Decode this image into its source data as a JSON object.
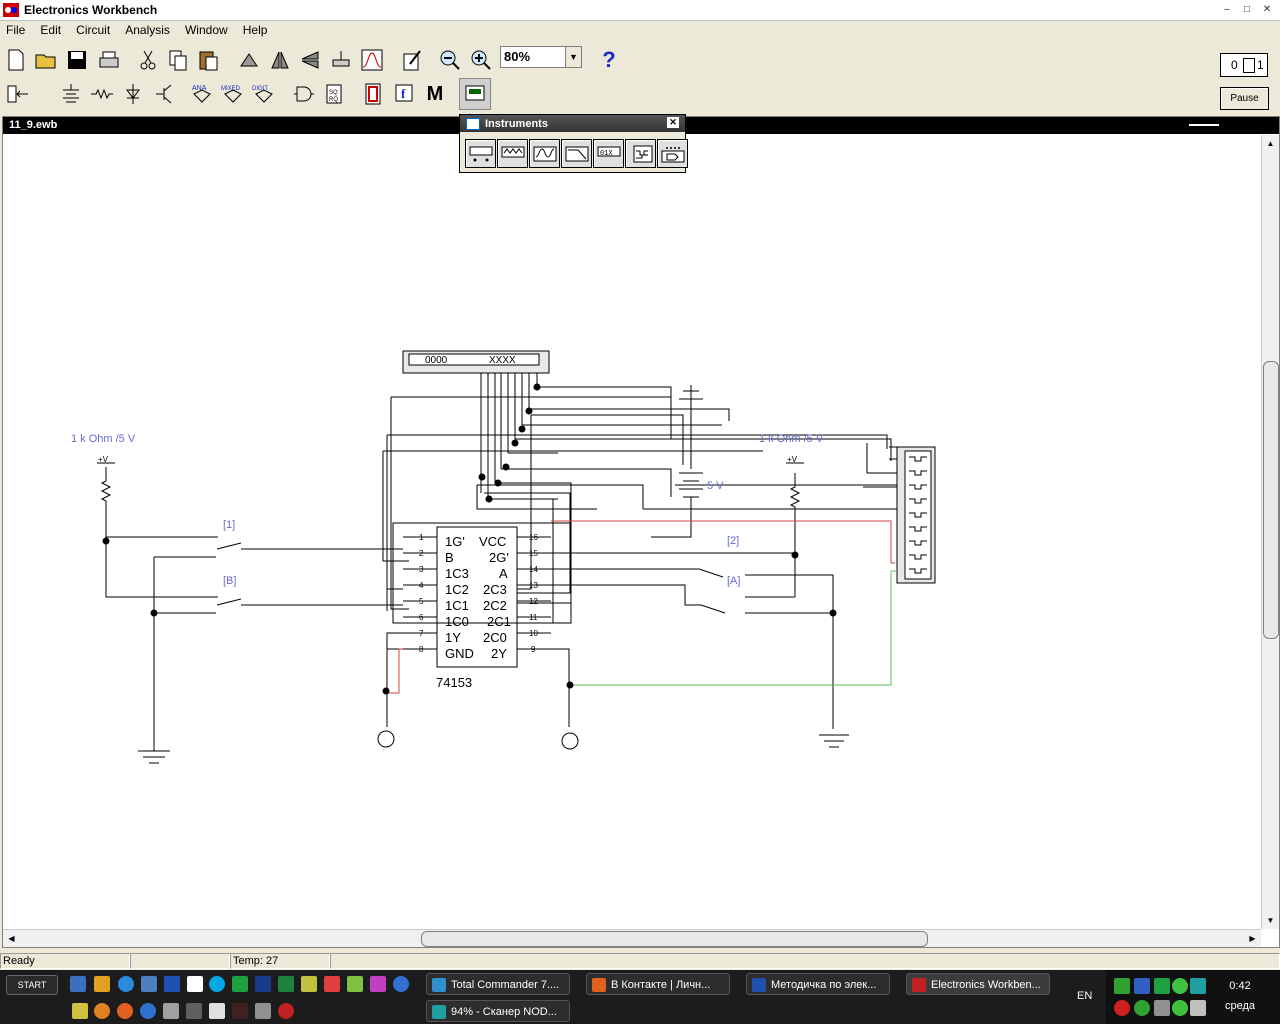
{
  "window": {
    "title": "Electronics Workbench",
    "minimize": "–",
    "maximize": "□",
    "close": "✕"
  },
  "menu": [
    "File",
    "Edit",
    "Circuit",
    "Analysis",
    "Window",
    "Help"
  ],
  "toolbar": {
    "zoom": "80%",
    "help": "?",
    "pause": "Pause",
    "power_on": "1",
    "power_off": "0",
    "parts_labels": {
      "analog": "ANA",
      "mixed": "MIXED",
      "digital": "DIGIT",
      "misc": "M"
    }
  },
  "document": {
    "title": "11_9.ewb"
  },
  "instruments": {
    "title": "Instruments",
    "close": "✕"
  },
  "circuit": {
    "resistor_label_1": "1 k Ohm /5 V",
    "resistor_label_2": "1 k Ohm /5 V",
    "vcc_1": "+V",
    "vcc_2": "+V",
    "battery": "5 V",
    "switch_1": "[1]",
    "switch_B": "[B]",
    "switch_2": "[2]",
    "switch_A": "[A]",
    "word_gen_left": "0000",
    "word_gen_right": "XXXX",
    "chip_name": "74153",
    "left_pins": [
      "1",
      "2",
      "3",
      "4",
      "5",
      "6",
      "7",
      "8"
    ],
    "left_labels": [
      "1G'",
      "B",
      "1C3",
      "1C2",
      "1C1",
      "1C0",
      "1Y",
      "GND"
    ],
    "right_pins": [
      "16",
      "15",
      "14",
      "13",
      "12",
      "11",
      "10",
      "9"
    ],
    "right_labels": [
      "VCC",
      "2G'",
      "A",
      "2C3",
      "2C2",
      "2C1",
      "2C0",
      "2Y"
    ]
  },
  "status": {
    "ready": "Ready",
    "temp": "Temp: 27"
  },
  "taskbar": {
    "start": "START",
    "tasks": [
      "Total Commander 7....",
      "В Контакте | Личн...",
      "Методичка по элек...",
      "Electronics Workben...",
      "94% - Сканер NOD..."
    ],
    "lang": "EN",
    "time": "0:42",
    "day": "среда"
  },
  "colors": {
    "wire": "#000000",
    "label_blue": "#6a6ad0",
    "red_wire": "#d04040",
    "green_wire": "#60c060"
  }
}
